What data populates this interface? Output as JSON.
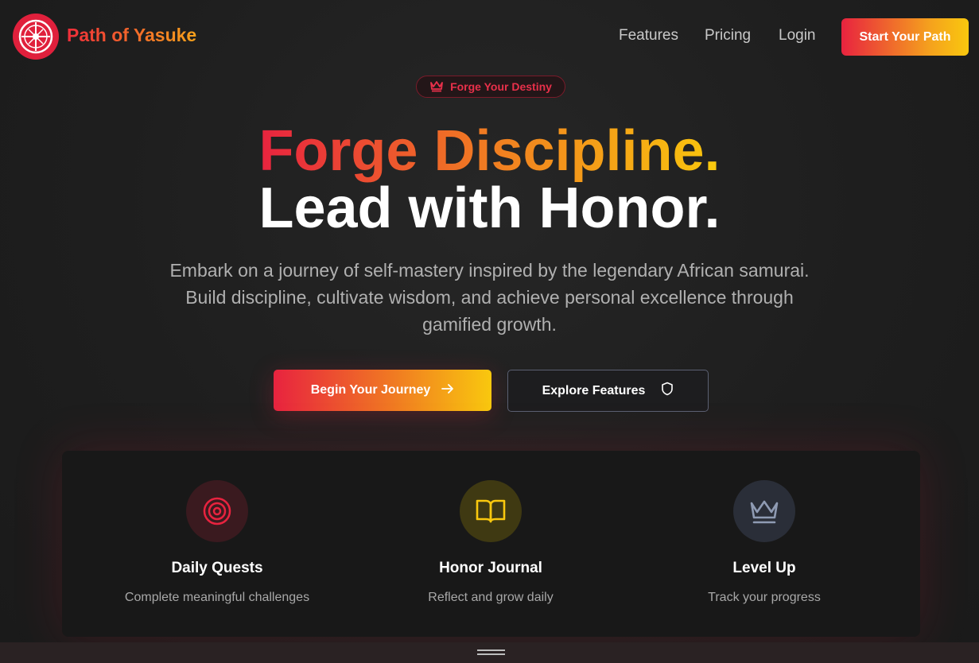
{
  "nav": {
    "brand": "Path of Yasuke",
    "links": [
      "Features",
      "Pricing",
      "Login"
    ],
    "cta": "Start Your Path"
  },
  "badge": {
    "icon": "crown-icon",
    "text": "Forge Your Destiny"
  },
  "hero": {
    "title_line1": "Forge Discipline",
    "title_line1_punct": ".",
    "title_line2": "Lead with Honor.",
    "lead": "Embark on a journey of self-mastery inspired by the legendary African samurai. Build discipline, cultivate wisdom, and achieve personal excellence through gamified growth."
  },
  "buttons": {
    "primary": "Begin Your Journey",
    "primary_icon": "arrow-right-icon",
    "secondary": "Explore Features",
    "secondary_icon": "shield-icon"
  },
  "features": [
    {
      "icon": "target-icon",
      "title": "Daily Quests",
      "desc": "Complete meaningful challenges",
      "color": "#e8233f"
    },
    {
      "icon": "book-open-icon",
      "title": "Honor Journal",
      "desc": "Reflect and grow daily",
      "color": "#f9c80e"
    },
    {
      "icon": "crown-icon",
      "title": "Level Up",
      "desc": "Track your progress",
      "color": "#8f9bb3"
    }
  ],
  "colors": {
    "accent_red": "#e8233f",
    "accent_orange": "#f07a22",
    "accent_yellow": "#f9c80e",
    "background": "#1e1e1e"
  }
}
